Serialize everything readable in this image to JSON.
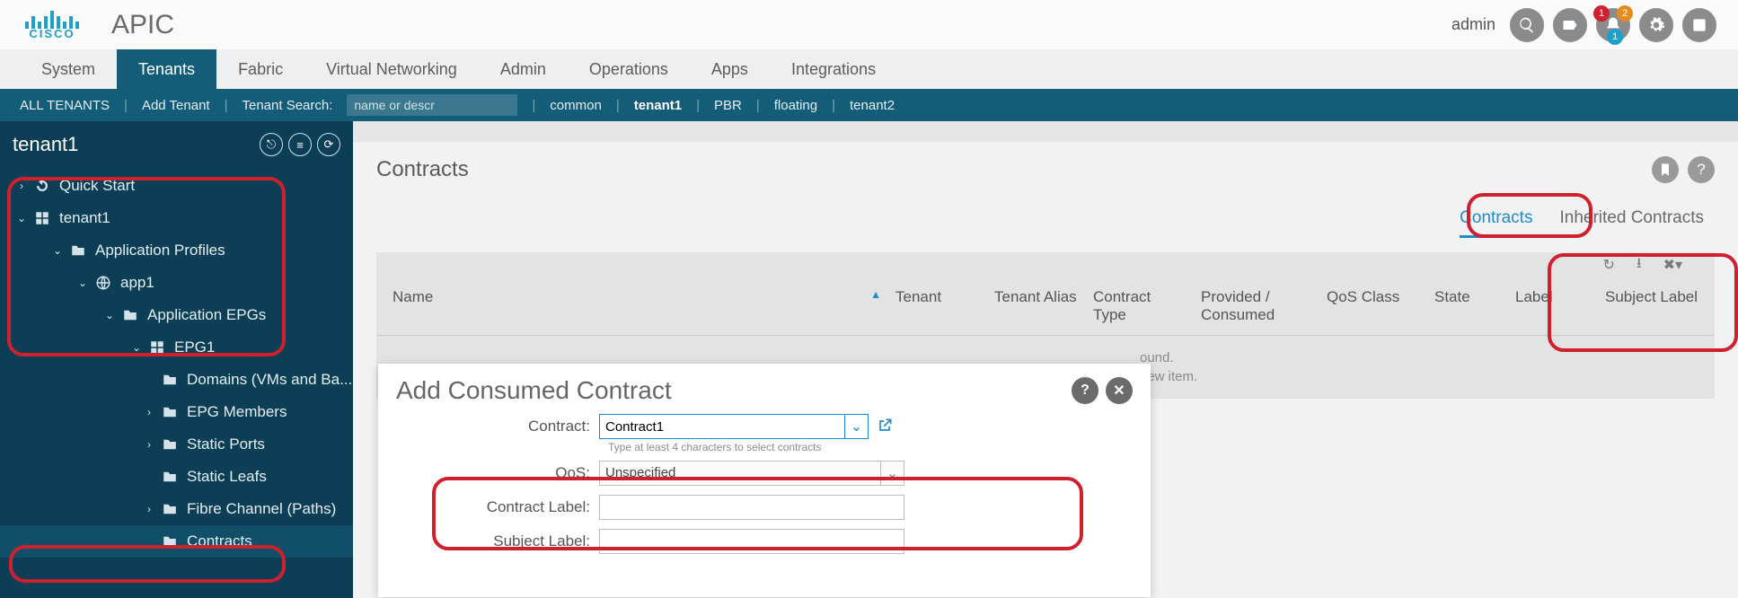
{
  "header": {
    "brand": "CISCO",
    "app": "APIC",
    "user": "admin",
    "badges": {
      "red": "1",
      "orange": "2",
      "teal": "1"
    }
  },
  "nav": {
    "items": [
      "System",
      "Tenants",
      "Fabric",
      "Virtual Networking",
      "Admin",
      "Operations",
      "Apps",
      "Integrations"
    ],
    "activeIndex": 1
  },
  "subbar": {
    "allTenants": "ALL TENANTS",
    "addTenant": "Add Tenant",
    "searchLabel": "Tenant Search:",
    "searchPlaceholder": "name or descr",
    "links": [
      "common",
      "tenant1",
      "PBR",
      "floating",
      "tenant2"
    ],
    "boldIndex": 1
  },
  "sidebar": {
    "title": "tenant1",
    "tree": [
      {
        "label": "Quick Start",
        "caret": ">",
        "icon": "arrow-cycle",
        "indent": 0
      },
      {
        "label": "tenant1",
        "caret": "v",
        "icon": "grid",
        "indent": 0
      },
      {
        "label": "Application Profiles",
        "caret": "v",
        "icon": "folder",
        "indent": 2
      },
      {
        "label": "app1",
        "caret": "v",
        "icon": "globe",
        "indent": 3
      },
      {
        "label": "Application EPGs",
        "caret": "v",
        "icon": "folder",
        "indent": 4
      },
      {
        "label": "EPG1",
        "caret": "v",
        "icon": "epg",
        "indent": 5
      },
      {
        "label": "Domains (VMs and Ba...",
        "caret": "",
        "icon": "folder",
        "indent": 6
      },
      {
        "label": "EPG Members",
        "caret": ">",
        "icon": "folder",
        "indent": 6
      },
      {
        "label": "Static Ports",
        "caret": ">",
        "icon": "folder",
        "indent": 6
      },
      {
        "label": "Static Leafs",
        "caret": "",
        "icon": "folder",
        "indent": 6
      },
      {
        "label": "Fibre Channel (Paths)",
        "caret": ">",
        "icon": "folder",
        "indent": 6
      },
      {
        "label": "Contracts",
        "caret": "",
        "icon": "folder",
        "indent": 6,
        "selected": true
      }
    ]
  },
  "panel": {
    "title": "Contracts",
    "tabs": [
      {
        "label": "Contracts",
        "active": true
      },
      {
        "label": "Inherited Contracts",
        "active": false
      }
    ],
    "columns": [
      "Name",
      "Tenant",
      "Tenant Alias",
      "Contract Type",
      "Provided / Consumed",
      "QoS Class",
      "State",
      "Label",
      "Subject Label"
    ],
    "emptyMsg1": "ound.",
    "emptyMsg2": "new item.",
    "sortIndicator": "▲"
  },
  "dialog": {
    "title": "Add Consumed Contract",
    "fields": {
      "contractLabel": "Contract:",
      "contractValue": "Contract1",
      "contractHint": "Type at least 4 characters to select contracts",
      "qosLabel": "QoS:",
      "qosValue": "Unspecified",
      "clLabel": "Contract Label:",
      "clValue": "",
      "slLabel": "Subject Label:",
      "slValue": ""
    }
  }
}
